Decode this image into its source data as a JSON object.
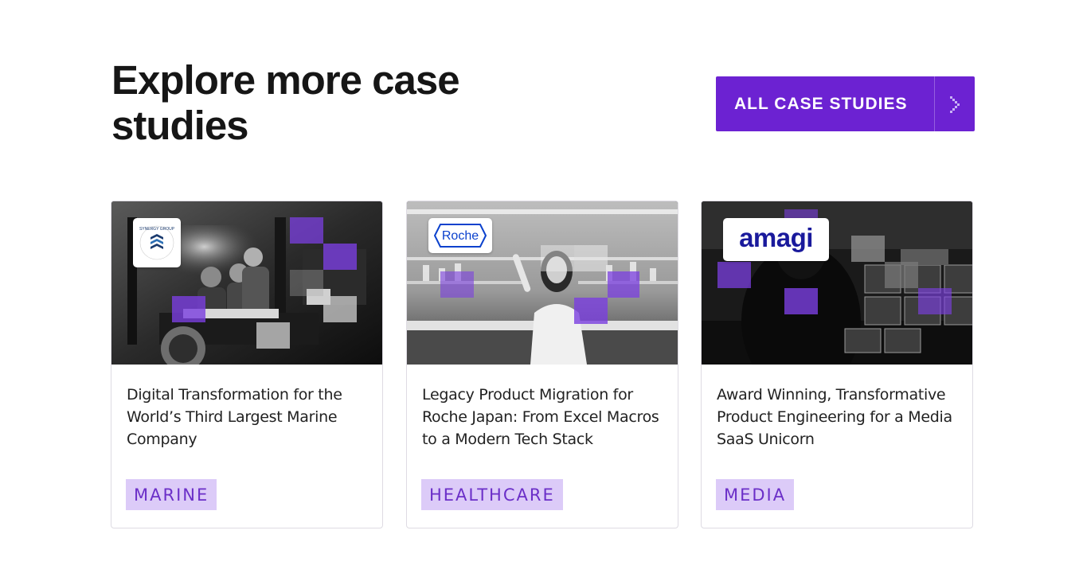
{
  "header": {
    "title": "Explore more case studies",
    "cta_label": "ALL CASE STUDIES",
    "cta_color": "#6c22d2"
  },
  "cards": [
    {
      "title": "Digital Transformation for the World’s Third Largest Marine Company",
      "tag": "MARINE",
      "logo_text": "SYNERGY GROUP",
      "logo_icon": "synergy-group-logo"
    },
    {
      "title": "Legacy Product Migration for Roche Japan: From Excel Macros to a Modern Tech Stack",
      "tag": "HEALTHCARE",
      "logo_text": "Roche",
      "logo_icon": "roche-logo"
    },
    {
      "title": "Award Winning, Transformative Product Engineering for a Media SaaS Unicorn",
      "tag": "MEDIA",
      "logo_text": "amagi",
      "logo_icon": "amagi-logo"
    }
  ],
  "colors": {
    "accent": "#6c22d2",
    "tag_bg": "#dccbf8",
    "tag_text": "#6b2fc8",
    "overlay_purple": "#7b3fe0"
  }
}
